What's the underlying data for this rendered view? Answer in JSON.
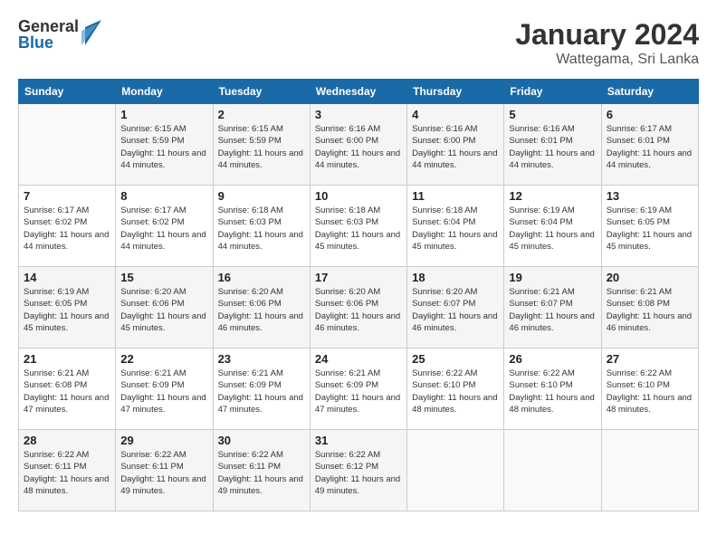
{
  "logo": {
    "general": "General",
    "blue": "Blue"
  },
  "title": "January 2024",
  "location": "Wattegama, Sri Lanka",
  "days_of_week": [
    "Sunday",
    "Monday",
    "Tuesday",
    "Wednesday",
    "Thursday",
    "Friday",
    "Saturday"
  ],
  "weeks": [
    [
      {
        "day": "",
        "sunrise": "",
        "sunset": "",
        "daylight": "",
        "empty": true
      },
      {
        "day": "1",
        "sunrise": "Sunrise: 6:15 AM",
        "sunset": "Sunset: 5:59 PM",
        "daylight": "Daylight: 11 hours and 44 minutes."
      },
      {
        "day": "2",
        "sunrise": "Sunrise: 6:15 AM",
        "sunset": "Sunset: 5:59 PM",
        "daylight": "Daylight: 11 hours and 44 minutes."
      },
      {
        "day": "3",
        "sunrise": "Sunrise: 6:16 AM",
        "sunset": "Sunset: 6:00 PM",
        "daylight": "Daylight: 11 hours and 44 minutes."
      },
      {
        "day": "4",
        "sunrise": "Sunrise: 6:16 AM",
        "sunset": "Sunset: 6:00 PM",
        "daylight": "Daylight: 11 hours and 44 minutes."
      },
      {
        "day": "5",
        "sunrise": "Sunrise: 6:16 AM",
        "sunset": "Sunset: 6:01 PM",
        "daylight": "Daylight: 11 hours and 44 minutes."
      },
      {
        "day": "6",
        "sunrise": "Sunrise: 6:17 AM",
        "sunset": "Sunset: 6:01 PM",
        "daylight": "Daylight: 11 hours and 44 minutes."
      }
    ],
    [
      {
        "day": "7",
        "sunrise": "Sunrise: 6:17 AM",
        "sunset": "Sunset: 6:02 PM",
        "daylight": "Daylight: 11 hours and 44 minutes."
      },
      {
        "day": "8",
        "sunrise": "Sunrise: 6:17 AM",
        "sunset": "Sunset: 6:02 PM",
        "daylight": "Daylight: 11 hours and 44 minutes."
      },
      {
        "day": "9",
        "sunrise": "Sunrise: 6:18 AM",
        "sunset": "Sunset: 6:03 PM",
        "daylight": "Daylight: 11 hours and 44 minutes."
      },
      {
        "day": "10",
        "sunrise": "Sunrise: 6:18 AM",
        "sunset": "Sunset: 6:03 PM",
        "daylight": "Daylight: 11 hours and 45 minutes."
      },
      {
        "day": "11",
        "sunrise": "Sunrise: 6:18 AM",
        "sunset": "Sunset: 6:04 PM",
        "daylight": "Daylight: 11 hours and 45 minutes."
      },
      {
        "day": "12",
        "sunrise": "Sunrise: 6:19 AM",
        "sunset": "Sunset: 6:04 PM",
        "daylight": "Daylight: 11 hours and 45 minutes."
      },
      {
        "day": "13",
        "sunrise": "Sunrise: 6:19 AM",
        "sunset": "Sunset: 6:05 PM",
        "daylight": "Daylight: 11 hours and 45 minutes."
      }
    ],
    [
      {
        "day": "14",
        "sunrise": "Sunrise: 6:19 AM",
        "sunset": "Sunset: 6:05 PM",
        "daylight": "Daylight: 11 hours and 45 minutes."
      },
      {
        "day": "15",
        "sunrise": "Sunrise: 6:20 AM",
        "sunset": "Sunset: 6:06 PM",
        "daylight": "Daylight: 11 hours and 45 minutes."
      },
      {
        "day": "16",
        "sunrise": "Sunrise: 6:20 AM",
        "sunset": "Sunset: 6:06 PM",
        "daylight": "Daylight: 11 hours and 46 minutes."
      },
      {
        "day": "17",
        "sunrise": "Sunrise: 6:20 AM",
        "sunset": "Sunset: 6:06 PM",
        "daylight": "Daylight: 11 hours and 46 minutes."
      },
      {
        "day": "18",
        "sunrise": "Sunrise: 6:20 AM",
        "sunset": "Sunset: 6:07 PM",
        "daylight": "Daylight: 11 hours and 46 minutes."
      },
      {
        "day": "19",
        "sunrise": "Sunrise: 6:21 AM",
        "sunset": "Sunset: 6:07 PM",
        "daylight": "Daylight: 11 hours and 46 minutes."
      },
      {
        "day": "20",
        "sunrise": "Sunrise: 6:21 AM",
        "sunset": "Sunset: 6:08 PM",
        "daylight": "Daylight: 11 hours and 46 minutes."
      }
    ],
    [
      {
        "day": "21",
        "sunrise": "Sunrise: 6:21 AM",
        "sunset": "Sunset: 6:08 PM",
        "daylight": "Daylight: 11 hours and 47 minutes."
      },
      {
        "day": "22",
        "sunrise": "Sunrise: 6:21 AM",
        "sunset": "Sunset: 6:09 PM",
        "daylight": "Daylight: 11 hours and 47 minutes."
      },
      {
        "day": "23",
        "sunrise": "Sunrise: 6:21 AM",
        "sunset": "Sunset: 6:09 PM",
        "daylight": "Daylight: 11 hours and 47 minutes."
      },
      {
        "day": "24",
        "sunrise": "Sunrise: 6:21 AM",
        "sunset": "Sunset: 6:09 PM",
        "daylight": "Daylight: 11 hours and 47 minutes."
      },
      {
        "day": "25",
        "sunrise": "Sunrise: 6:22 AM",
        "sunset": "Sunset: 6:10 PM",
        "daylight": "Daylight: 11 hours and 48 minutes."
      },
      {
        "day": "26",
        "sunrise": "Sunrise: 6:22 AM",
        "sunset": "Sunset: 6:10 PM",
        "daylight": "Daylight: 11 hours and 48 minutes."
      },
      {
        "day": "27",
        "sunrise": "Sunrise: 6:22 AM",
        "sunset": "Sunset: 6:10 PM",
        "daylight": "Daylight: 11 hours and 48 minutes."
      }
    ],
    [
      {
        "day": "28",
        "sunrise": "Sunrise: 6:22 AM",
        "sunset": "Sunset: 6:11 PM",
        "daylight": "Daylight: 11 hours and 48 minutes."
      },
      {
        "day": "29",
        "sunrise": "Sunrise: 6:22 AM",
        "sunset": "Sunset: 6:11 PM",
        "daylight": "Daylight: 11 hours and 49 minutes."
      },
      {
        "day": "30",
        "sunrise": "Sunrise: 6:22 AM",
        "sunset": "Sunset: 6:11 PM",
        "daylight": "Daylight: 11 hours and 49 minutes."
      },
      {
        "day": "31",
        "sunrise": "Sunrise: 6:22 AM",
        "sunset": "Sunset: 6:12 PM",
        "daylight": "Daylight: 11 hours and 49 minutes."
      },
      {
        "day": "",
        "sunrise": "",
        "sunset": "",
        "daylight": "",
        "empty": true
      },
      {
        "day": "",
        "sunrise": "",
        "sunset": "",
        "daylight": "",
        "empty": true
      },
      {
        "day": "",
        "sunrise": "",
        "sunset": "",
        "daylight": "",
        "empty": true
      }
    ]
  ]
}
